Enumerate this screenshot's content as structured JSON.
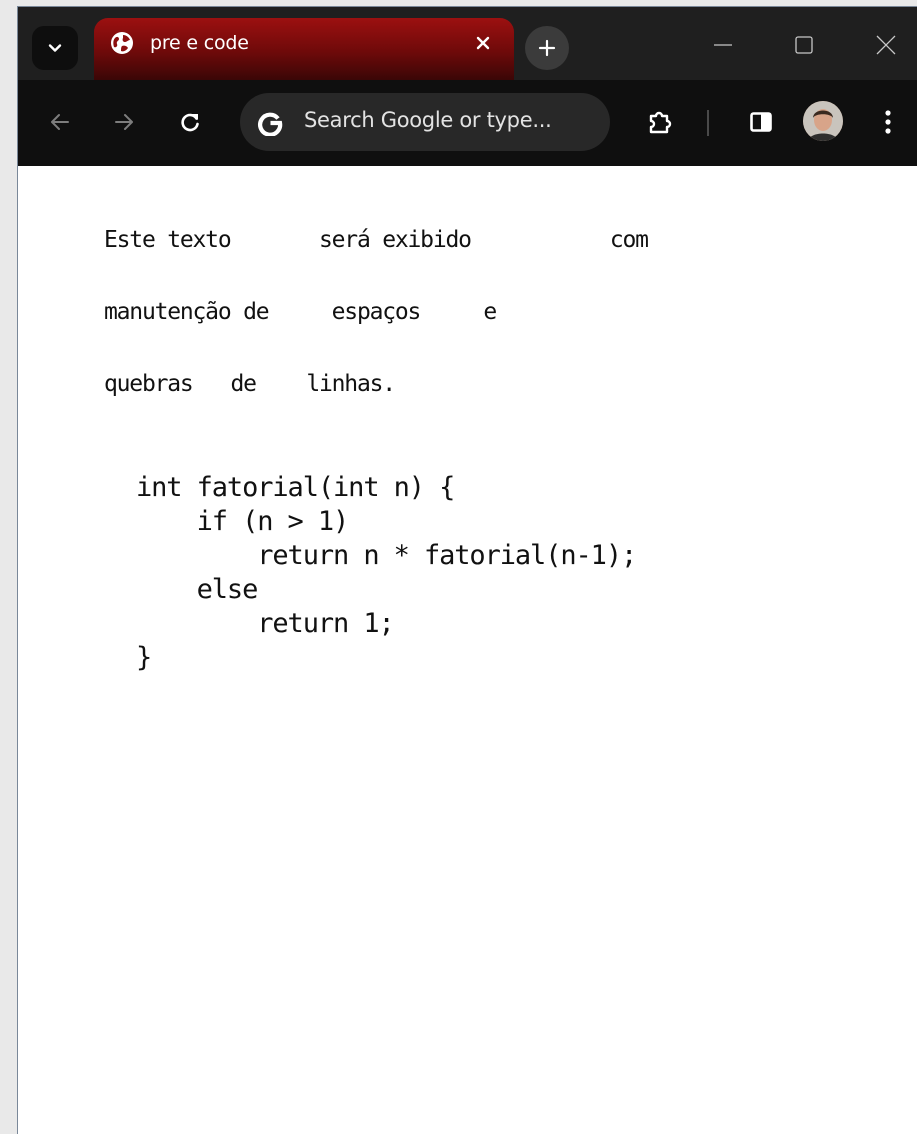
{
  "browser": {
    "tab": {
      "title": "pre e code",
      "favicon": "globe-icon"
    },
    "omnibox": {
      "placeholder": "Search Google or type..."
    },
    "colors": {
      "tab_accent": "#8b0e0e",
      "titlebar": "#1f1f1f",
      "toolbar": "#0f0f0f",
      "omnibox": "#282828"
    }
  },
  "page": {
    "pre_text": "Este texto       será exibido           com\nmanutenção de     espaços     e\nquebras   de    linhas.",
    "code": "int fatorial(int n) {\n    if (n > 1)\n        return n * fatorial(n-1);\n    else\n        return 1;\n}"
  }
}
